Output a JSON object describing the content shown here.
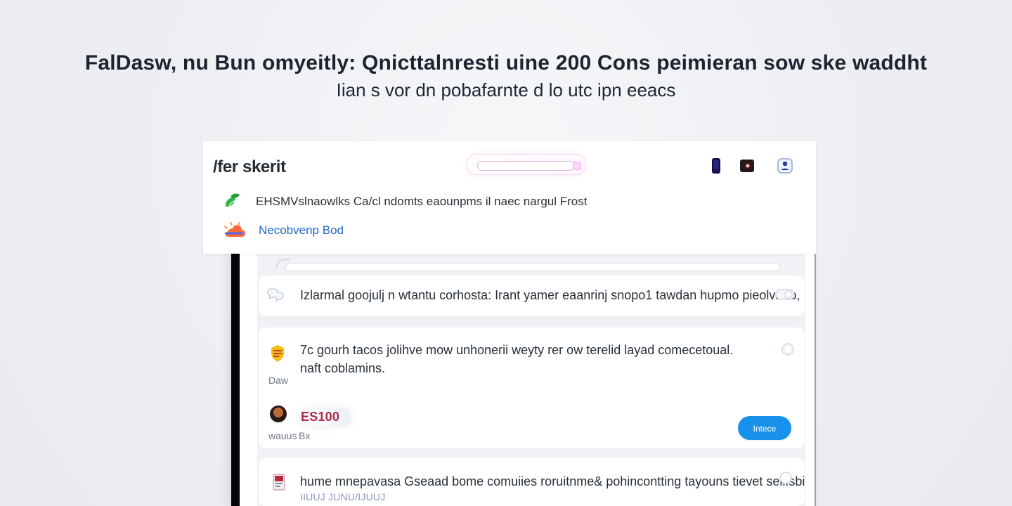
{
  "hero": {
    "title": "FalDasw, nu Bun omyeitly: Qnicttalnresti uine 200 Cons peimieran sow ske waddht",
    "subtitle": "Iian s vor dn pobafarnte d lo utc ipn eeacs"
  },
  "popover": {
    "brand": "/fer skerit",
    "header_icons": [
      "mobile-icon",
      "camera-icon",
      "profile-icon"
    ],
    "row_1_text": "EHSMVslnaowlks Ca/cl ndomts eaounpms il naec nargul Frost",
    "row_2_link": "Necobvenp Bod"
  },
  "feed": {
    "card_1_text": "Izlarmal goojulj n wtantu corhosta: Irant yamer eaanrinj snopo1 tawdan hupmo pieolvanb,",
    "card_2_text_line_1": "7c gourh tacos jolihve mow unhonerii weyty rer ow terelid layad comecetoual.",
    "card_2_text_line_2": "naft coblamins.",
    "card_2_meta_1": "Daw",
    "card_2_meta_2": "wauus",
    "card_2_meta_3": "Bx",
    "score": "ES100",
    "action_button": "Intece",
    "card_3_text": "hume mnepavasa Gseaad bome comuiies roruitnme& pohincontting tayouns tievet seilfsbi",
    "card_3_meta": "IIUUJ JUNU/IJUUJ"
  },
  "colors": {
    "background": "#eeeff3",
    "accent_blue": "#1791ec",
    "link_blue": "#1f67c9",
    "score_red": "#ab2b48"
  }
}
